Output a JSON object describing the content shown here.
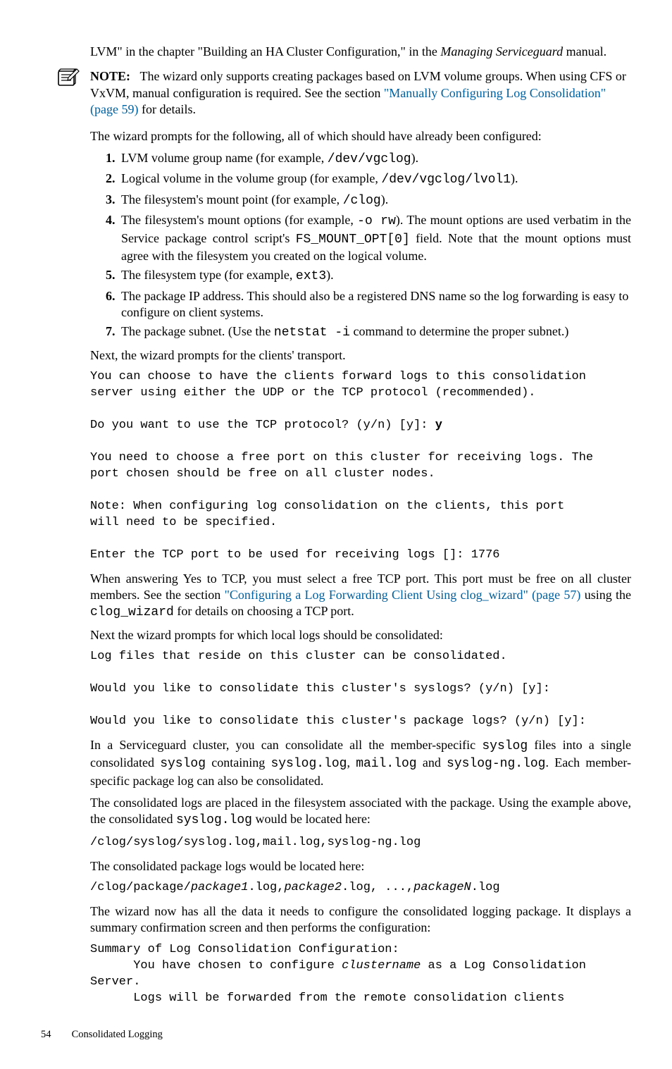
{
  "intro": {
    "pre": "LVM\" in the chapter \"Building an HA Cluster Configuration,\" in the ",
    "em": "Managing Serviceguard",
    "post": " manual."
  },
  "note": {
    "label": "NOTE:",
    "tail": " for details.",
    "t1": "The wizard only supports creating packages based on LVM volume groups. When using CFS or VxVM, manual configuration is required. See the section ",
    "link": "\"Manually Configuring Log Consolidation\" (page 59)"
  },
  "prompts_intro": "The wizard prompts for the following, all of which should have already been configured:",
  "li1": {
    "a": "LVM volume group name (for example, ",
    "code": "/dev/vgclog",
    "b": ")."
  },
  "li2": {
    "a": "Logical volume in the volume group (for example, ",
    "code": "/dev/vgclog/lvol1",
    "b": ")."
  },
  "li3": {
    "a": "The filesystem's mount point (for example, ",
    "code": "/clog",
    "b": ")."
  },
  "li4": {
    "a": "The filesystem's mount options (for example, ",
    "code1": "-o rw",
    "b": "). The mount options are used verbatim in the Service package control script's ",
    "code2": "FS_MOUNT_OPT[0]",
    "c": " field. Note that the mount options must agree with the filesystem you created on the logical volume."
  },
  "li5": {
    "a": "The filesystem type (for example, ",
    "code": "ext3",
    "b": ")."
  },
  "li6": "The package IP address. This should also be a registered DNS name so the log forwarding is easy to configure on client systems.",
  "li7": {
    "a": "The package subnet. (Use the ",
    "code": "netstat -i",
    "b": " command to determine the proper subnet.)"
  },
  "next_transport": "Next, the wizard prompts for the clients' transport.",
  "code1": "You can choose to have the clients forward logs to this consolidation\nserver using either the UDP or the TCP protocol (recommended).\n\nDo you want to use the TCP protocol? (y/n) [y]: ",
  "code1_bold": "y",
  "code1b": "\n\nYou need to choose a free port on this cluster for receiving logs. The\nport chosen should be free on all cluster nodes.\n\nNote: When configuring log consolidation on the clients, this port\nwill need to be specified.\n\nEnter the TCP port to be used for receiving logs []: 1776",
  "tcp_para": {
    "a": "When answering Yes to TCP, you must select a free TCP port. This port must be free on all cluster members. See the section ",
    "link": "\"Configuring a Log Forwarding Client Using clog_wizard\" (page 57)",
    "b": " using the ",
    "code": "clog_wizard",
    "c": " for details on choosing a TCP port."
  },
  "next_local": "Next the wizard prompts for which local logs should be consolidated:",
  "code2": "Log files that reside on this cluster can be consolidated.\n\nWould you like to consolidate this cluster's syslogs? (y/n) [y]:\n\nWould you like to consolidate this cluster's package logs? (y/n) [y]:",
  "sg_para": {
    "a": "In a Serviceguard cluster, you can consolidate all the member-specific ",
    "c1": "syslog",
    "b": " files into a single consolidated ",
    "c2": "syslog",
    "c": " containing ",
    "c3": "syslog.log",
    "d": ", ",
    "c4": "mail.log",
    "e": " and ",
    "c5": "syslog-ng.log",
    "f": ". Each member-specific package log can also be consolidated."
  },
  "cons_para": {
    "a": "The consolidated logs are placed in the filesystem associated with the package. Using the example above, the consolidated ",
    "code": "syslog.log",
    "b": " would be located here:"
  },
  "path1": "/clog/syslog/syslog.log,mail.log,syslog-ng.log",
  "pkg_located": "The consolidated package logs would be located here:",
  "path2": {
    "a": "/clog/package/",
    "i1": "package1",
    "b": ".log,",
    "i2": "package2",
    "c": ".log, ...,",
    "i3": "packageN",
    "d": ".log"
  },
  "final_para": "The wizard now has all the data it needs to configure the consolidated logging package. It displays a summary confirmation screen and then performs the configuration:",
  "code3a": "Summary of Log Consolidation Configuration:\n      You have chosen to configure ",
  "code3_em": "clustername",
  "code3b": " as a Log Consolidation Server.\n      Logs will be forwarded from the remote consolidation clients",
  "footer": {
    "page": "54",
    "title": "Consolidated Logging"
  }
}
